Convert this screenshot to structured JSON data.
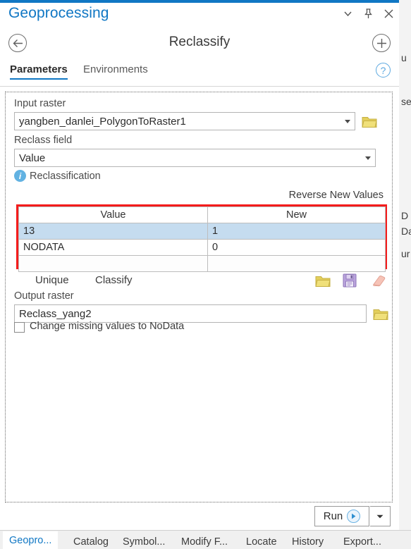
{
  "pane": {
    "title": "Geoprocessing",
    "window_buttons": [
      {
        "name": "menu-chevron",
        "glyph": "chevron-down-icon"
      },
      {
        "name": "pin",
        "glyph": "pin-icon"
      },
      {
        "name": "close",
        "glyph": "close-icon"
      }
    ],
    "accent_color": "#1077c4"
  },
  "tool_header": {
    "back_label": "back-arrow-icon",
    "tool_title": "Reclassify",
    "add_label": "plus-icon"
  },
  "tabs": {
    "active": "Parameters",
    "inactive": "Environments",
    "help": "?"
  },
  "parameters": {
    "input_raster": {
      "label": "Input raster",
      "value": "yangben_danlei_PolygonToRaster1",
      "placeholder": "",
      "browse_icon": "folder-icon"
    },
    "reclass_field": {
      "label": "Reclass field",
      "value": "Value",
      "placeholder": ""
    },
    "reclassification": {
      "label": "Reclassification",
      "info_glyph": "i",
      "reverse_label": "Reverse New Values",
      "columns": [
        "Value",
        "New"
      ],
      "rows": [
        {
          "value": "13",
          "new": "1",
          "selected": true
        },
        {
          "value": "NODATA",
          "new": "0",
          "selected": false
        },
        {
          "value": "",
          "new": "",
          "selected": false
        }
      ],
      "highlight_color": "#f41c1c"
    },
    "actions": {
      "unique_label": "Unique",
      "classify_label": "Classify",
      "icons": [
        {
          "name": "load-folder-icon",
          "color": "#d9c64a"
        },
        {
          "name": "save-disk-icon",
          "color": "#9e86c8"
        },
        {
          "name": "eraser-icon",
          "color": "#f0b0a4"
        }
      ]
    },
    "output_raster": {
      "label": "Output raster",
      "value": "Reclass_yang2",
      "placeholder": "",
      "browse_icon": "folder-icon"
    },
    "change_missing": {
      "label": "Change missing values to NoData",
      "checked": false
    }
  },
  "footer": {
    "run_label": "Run",
    "run_icon": "play-icon",
    "dropdown_icon": "chevron-down-icon"
  },
  "bottom_tabs": [
    {
      "label": "Geopro...",
      "active": true
    },
    {
      "label": "Catalog",
      "active": false
    },
    {
      "label": "Symbol...",
      "active": false
    },
    {
      "label": "Modify F...",
      "active": false
    },
    {
      "label": "Locate",
      "active": false
    },
    {
      "label": "History",
      "active": false
    },
    {
      "label": "Export...",
      "active": false
    }
  ],
  "background_panel": {
    "fragments": [
      "u",
      "se",
      "D",
      "Da",
      "ur"
    ]
  }
}
